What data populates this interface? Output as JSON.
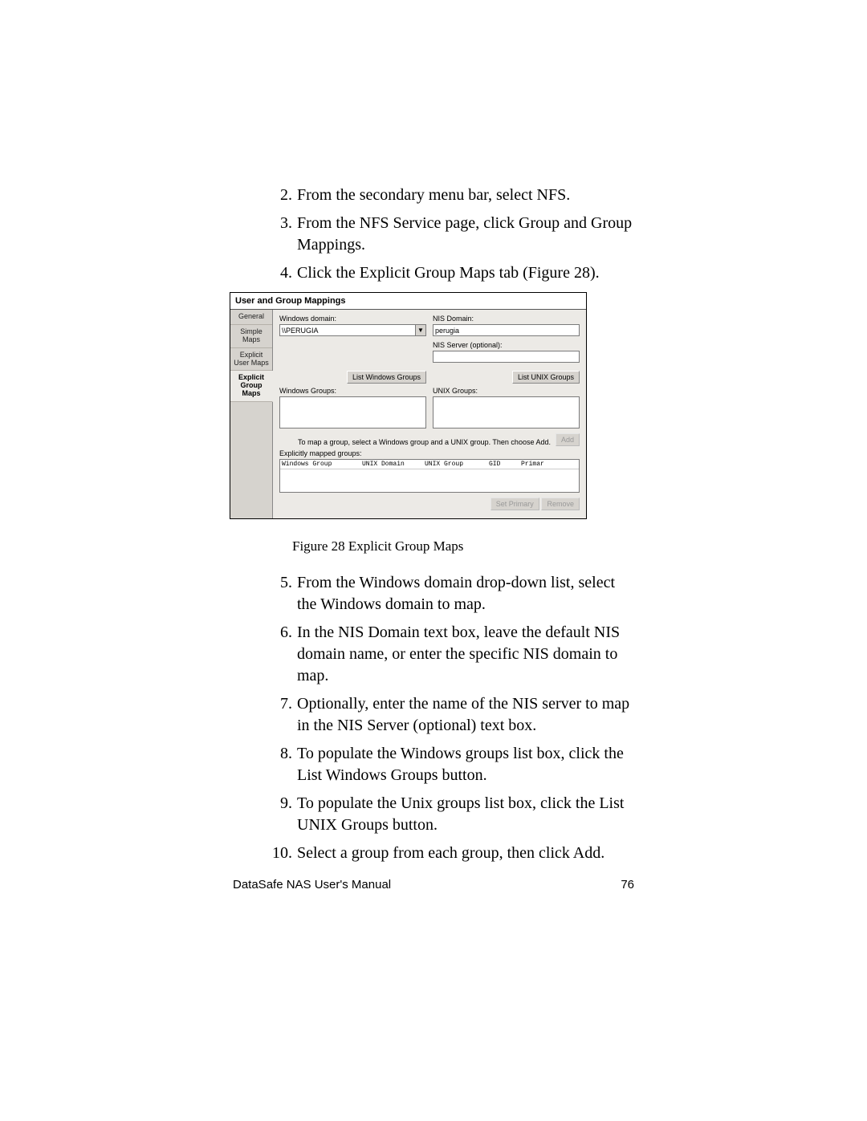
{
  "steps_top": [
    {
      "n": "2.",
      "text": "From the secondary menu bar, select NFS."
    },
    {
      "n": "3.",
      "text": "From the NFS Service page, click Group and Group Mappings."
    },
    {
      "n": "4.",
      "text": "Click the Explicit Group Maps tab (Figure 28)."
    }
  ],
  "dialog": {
    "title": "User and Group Mappings",
    "tabs": [
      "General",
      "Simple Maps",
      "Explicit User Maps",
      "Explicit Group Maps"
    ],
    "active_tab_index": 3,
    "windows_domain_label": "Windows domain:",
    "windows_domain_value": "\\\\PERUGIA",
    "nis_domain_label": "NIS Domain:",
    "nis_domain_value": "perugia",
    "nis_server_label": "NIS Server (optional):",
    "nis_server_value": "",
    "list_windows_btn": "List Windows Groups",
    "list_unix_btn": "List UNIX Groups",
    "windows_groups_label": "Windows Groups:",
    "unix_groups_label": "UNIX Groups:",
    "map_hint": "To map a group, select a Windows group and a UNIX group. Then choose Add.",
    "add_btn": "Add",
    "mapped_label": "Explicitly mapped groups:",
    "cols": {
      "c1": "Windows Group",
      "c2": "UNIX Domain",
      "c3": "UNIX Group",
      "c4": "GID",
      "c5": "Primar"
    },
    "set_primary_btn": "Set Primary",
    "remove_btn": "Remove"
  },
  "figure_caption": "Figure 28   Explicit Group Maps",
  "steps_bottom": [
    {
      "n": "5.",
      "text": "From the Windows domain drop-down list, select the Windows domain to map."
    },
    {
      "n": "6.",
      "text": "In the NIS Domain text box, leave the default NIS domain name, or enter the specific NIS domain to map."
    },
    {
      "n": "7.",
      "text": "Optionally, enter the name of the NIS server to map in the NIS Server (optional) text box."
    },
    {
      "n": "8.",
      "text": "To populate the Windows groups list box, click the List Windows Groups button."
    },
    {
      "n": "9.",
      "text": "To populate the Unix groups list box, click the List UNIX Groups button."
    },
    {
      "n": "10.",
      "text": "Select a group from each group, then click Add."
    }
  ],
  "footer": {
    "left": "DataSafe NAS User's Manual",
    "right": "76"
  }
}
